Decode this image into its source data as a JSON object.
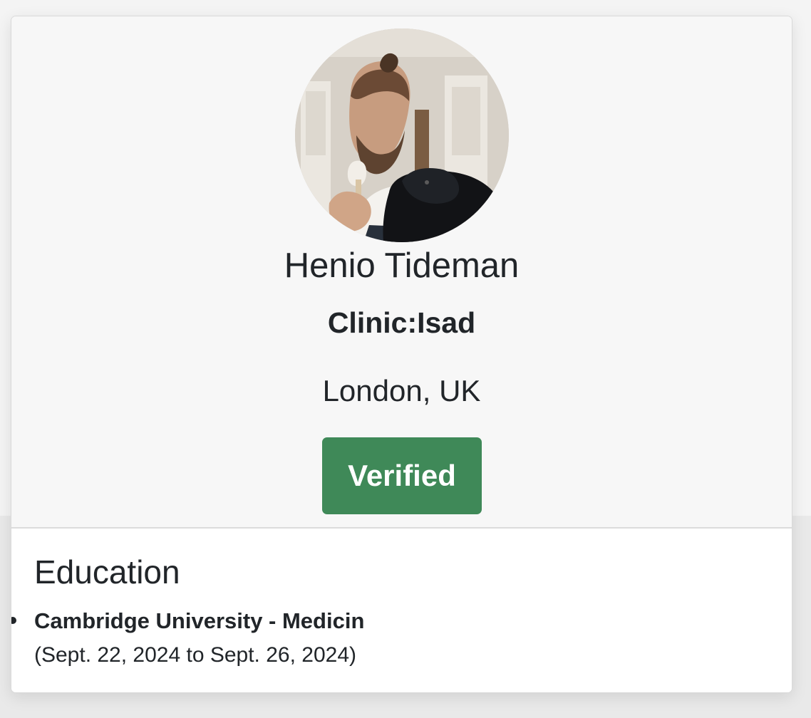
{
  "profile": {
    "name": "Henio Tideman",
    "clinic": "Clinic:Isad",
    "location": "London, UK",
    "status_label": "Verified",
    "status_color": "#3f8958"
  },
  "education": {
    "title": "Education",
    "items": [
      {
        "school": "Cambridge University - Medicin",
        "dates": "(Sept. 22, 2024 to Sept. 26, 2024)"
      }
    ]
  }
}
